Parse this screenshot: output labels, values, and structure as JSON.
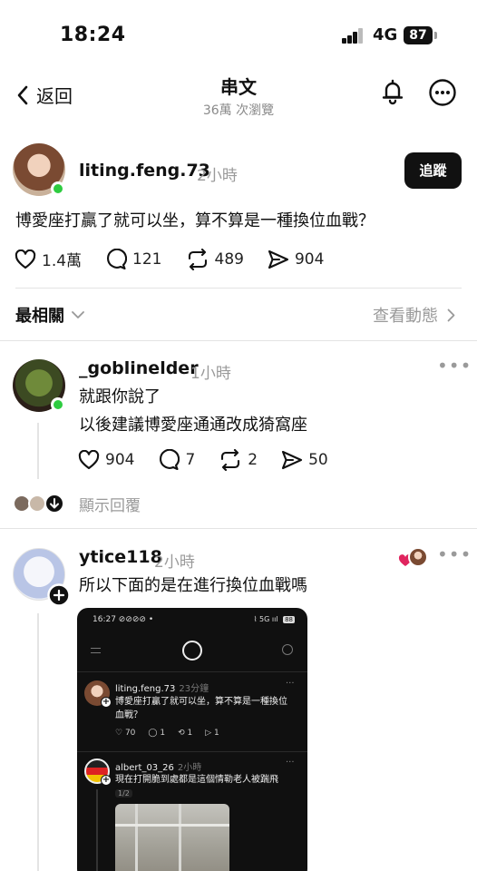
{
  "status_bar": {
    "time": "18:24",
    "network": "4G",
    "battery": "87"
  },
  "nav": {
    "back_label": "返回",
    "title": "串文",
    "subtitle": "36萬 次瀏覽"
  },
  "main_post": {
    "username": "liting.feng.73",
    "time": "2小時",
    "follow_label": "追蹤",
    "text": "博愛座打贏了就可以坐，算不算是一種換位血戰？",
    "likes": "1.4萬",
    "comments": "121",
    "reposts": "489",
    "shares": "904"
  },
  "sort": {
    "label": "最相關",
    "activity_link": "查看動態"
  },
  "replies": [
    {
      "username": "_goblinelder",
      "time": "1小時",
      "lines": [
        "就跟你說了",
        "以後建議博愛座通通改成猗窩座"
      ],
      "likes": "904",
      "comments": "7",
      "reposts": "2",
      "shares": "50",
      "show_replies_label": "顯示回覆"
    },
    {
      "username": "ytice118",
      "time": "2小時",
      "text": "所以下面的是在進行換位血戰嗎"
    }
  ],
  "embedded_screenshot": {
    "status_time": "16:27",
    "status_right": "5G",
    "battery": "88",
    "post": {
      "username": "liting.feng.73",
      "time": "23分鐘",
      "text_line1": "博愛座打贏了就可以坐，算不算是一種換位",
      "text_line2": "血戰？",
      "likes": "70",
      "comments": "1",
      "reposts": "1",
      "shares": "1"
    },
    "reply": {
      "username": "albert_03_26",
      "time": "2小時",
      "text": "現在打開脆到處都是這個情勒老人被踹飛",
      "page_badge": "1/2"
    }
  },
  "colors": {
    "online": "#2ecc40",
    "muted": "#9a9a9a",
    "heart": "#e0245e"
  }
}
